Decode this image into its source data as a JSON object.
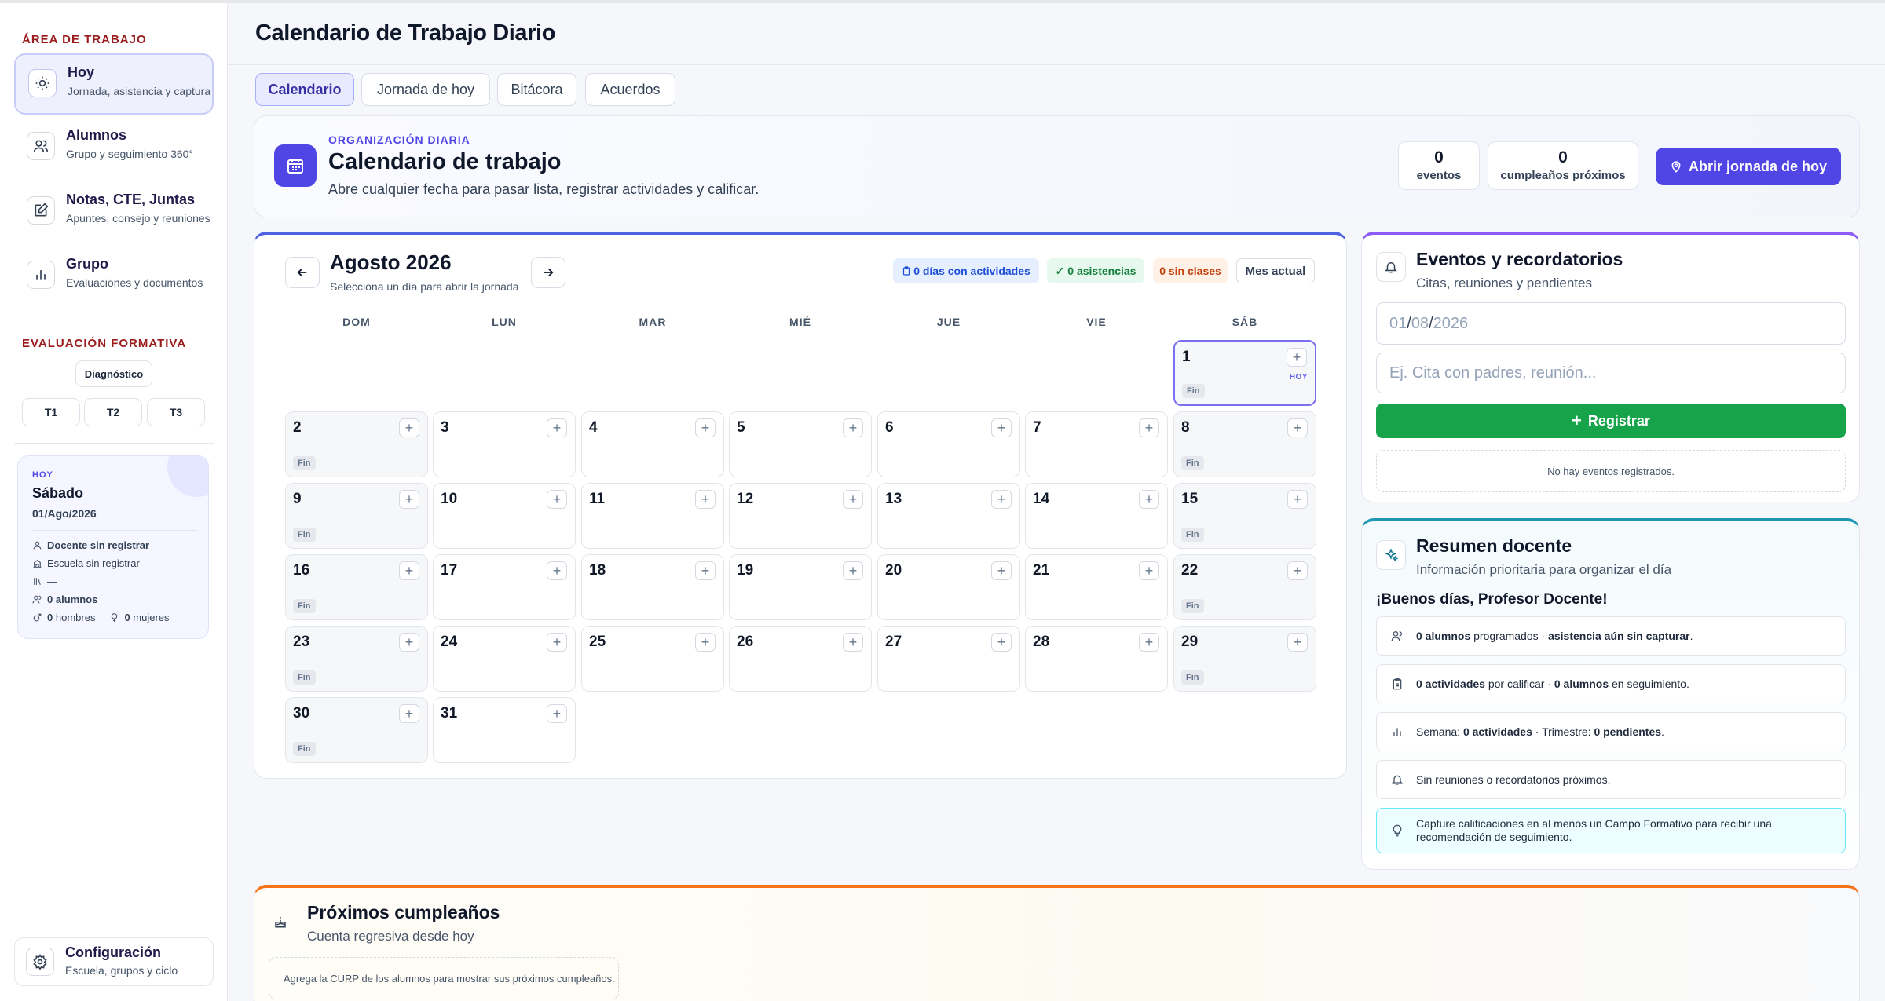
{
  "app": {
    "title": "Calendario de Trabajo Diario"
  },
  "sidebar": {
    "work_section": "ÁREA DE TRABAJO",
    "items": [
      {
        "label": "Hoy",
        "sub": "Jornada, asistencia y captura"
      },
      {
        "label": "Alumnos",
        "sub": "Grupo y seguimiento 360°"
      },
      {
        "label": "Notas, CTE, Juntas",
        "sub": "Apuntes, consejo y reuniones"
      },
      {
        "label": "Grupo",
        "sub": "Evaluaciones y documentos"
      }
    ],
    "eval_section": "EVALUACIÓN FORMATIVA",
    "diagnostic": "Diagnóstico",
    "terms": [
      "T1",
      "T2",
      "T3"
    ],
    "today_card": {
      "tag": "HOY",
      "day": "Sábado",
      "date": "01/Ago/2026",
      "teacher": "Docente sin registrar",
      "school": "Escuela sin registrar",
      "group": "—",
      "students_count": "0",
      "students_word": "alumnos",
      "men_count": "0",
      "men_word": "hombres",
      "women_count": "0",
      "women_word": "mujeres"
    },
    "config": {
      "label": "Configuración",
      "sub": "Escuela, grupos y ciclo"
    }
  },
  "tabs": [
    "Calendario",
    "Jornada de hoy",
    "Bitácora",
    "Acuerdos"
  ],
  "banner": {
    "eyebrow": "ORGANIZACIÓN DIARIA",
    "title": "Calendario de trabajo",
    "subtitle": "Abre cualquier fecha para pasar lista, registrar actividades y calificar.",
    "stats": [
      {
        "value": "0",
        "label": "eventos"
      },
      {
        "value": "0",
        "label": "cumpleaños próximos"
      }
    ],
    "open_button": "Abrir jornada de hoy"
  },
  "calendar": {
    "month": "Agosto 2026",
    "hint": "Selecciona un día para abrir la jornada",
    "badges": {
      "activities": "0 días con actividades",
      "attendance": "0 asistencias",
      "no_class": "0 sin clases",
      "current_month": "Mes actual"
    },
    "weekdays": [
      "DOM",
      "LUN",
      "MAR",
      "MIÉ",
      "JUE",
      "VIE",
      "SÁB"
    ],
    "first_weekday_index": 6,
    "days_in_month": 31,
    "today": 1,
    "weekend_tag": "Fin",
    "today_tag": "HOY",
    "add_glyph": "+"
  },
  "events": {
    "title": "Eventos y recordatorios",
    "subtitle": "Citas, reuniones y pendientes",
    "date_day": "01",
    "date_month": "08",
    "date_year": "2026",
    "placeholder": "Ej. Cita con padres, reunión...",
    "register": "Registrar",
    "empty": "No hay eventos registrados."
  },
  "summary": {
    "title": "Resumen docente",
    "subtitle": "Información prioritaria para organizar el día",
    "greeting": "¡Buenos días, Profesor Docente!",
    "row1": {
      "a": "0 alumnos",
      "b": " programados · ",
      "c": "asistencia aún sin capturar",
      "d": "."
    },
    "row2": {
      "a": "0 actividades",
      "b": " por calificar · ",
      "c": "0 alumnos",
      "d": " en seguimiento."
    },
    "row3": {
      "a": "Semana: ",
      "b": "0 actividades",
      "c": " · Trimestre: ",
      "d": "0 pendientes",
      "e": "."
    },
    "row4": "Sin reuniones o recordatorios próximos.",
    "tip": "Capture calificaciones en al menos un Campo Formativo para recibir una recomendación de seguimiento."
  },
  "birthdays": {
    "title": "Próximos cumpleaños",
    "subtitle": "Cuenta regresiva desde hoy",
    "empty": "Agrega la CURP de los alumnos para mostrar sus próximos cumpleaños."
  },
  "colors": {
    "accent": "#4f46e5",
    "green": "#16a34a",
    "sidebar_heading": "#9b1c1c",
    "calendar_top": "#4f62e0",
    "events_top": "#8b5cf6",
    "summary_top": "#1e97b4",
    "birthdays_top": "#f97316"
  }
}
